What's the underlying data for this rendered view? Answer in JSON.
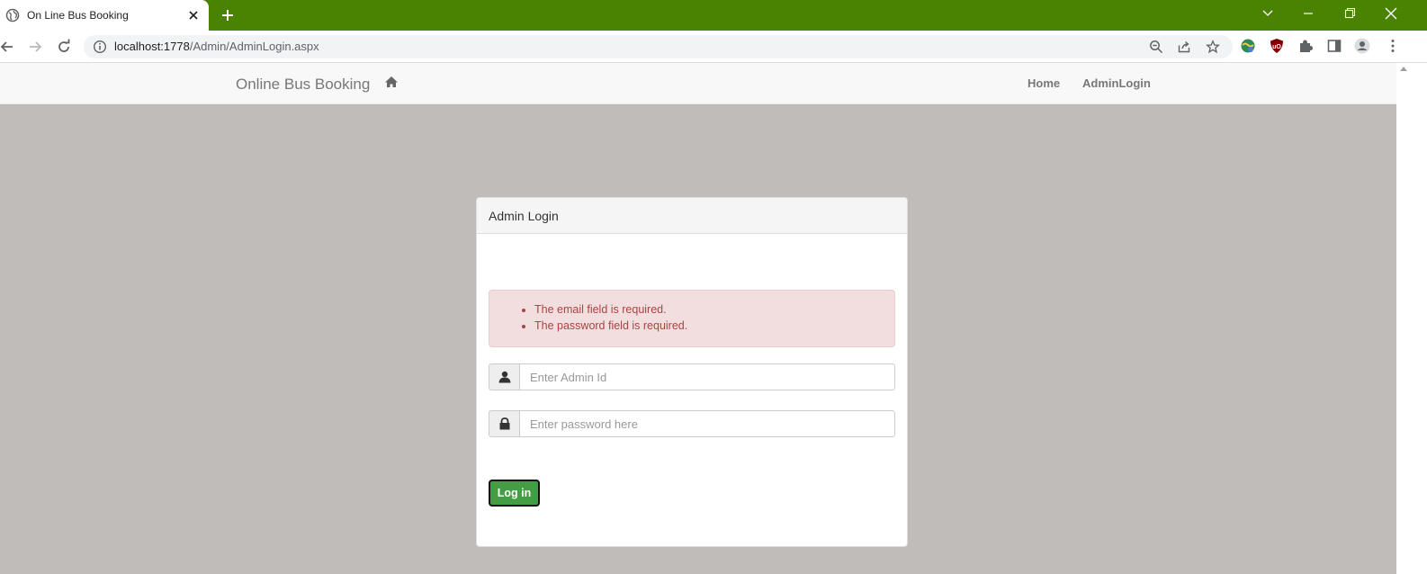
{
  "browser": {
    "tab_title": "On Line Bus Booking",
    "url_host": "localhost:1778",
    "url_path": "/Admin/AdminLogin.aspx",
    "theme_color": "#4a8202"
  },
  "navbar": {
    "brand": "Online Bus Booking",
    "links": [
      {
        "label": "Home"
      },
      {
        "label": "AdminLogin"
      }
    ]
  },
  "login_panel": {
    "title": "Admin Login",
    "errors": [
      "The email field is required.",
      "The password field is required."
    ],
    "admin_id": {
      "value": "",
      "placeholder": "Enter Admin Id",
      "icon": "user-icon"
    },
    "password": {
      "value": "",
      "placeholder": "Enter password here",
      "icon": "lock-icon"
    },
    "submit_label": "Log in",
    "submit_color": "#449d44",
    "error_color": "#a94442"
  }
}
